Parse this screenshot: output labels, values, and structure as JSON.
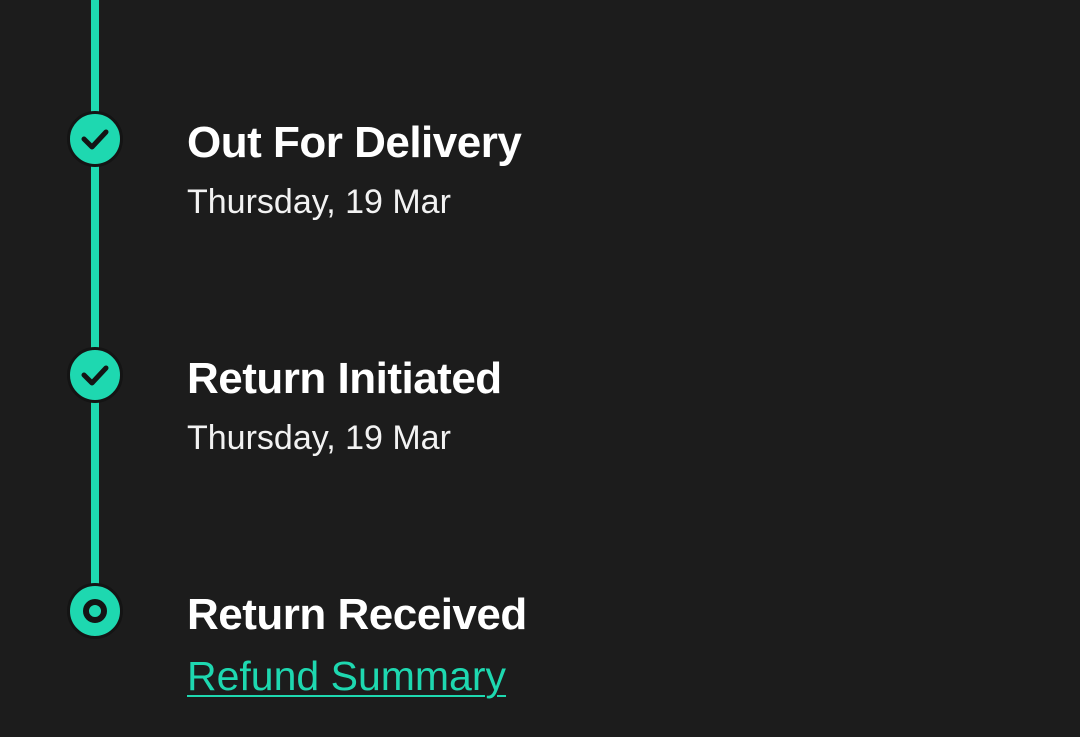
{
  "colors": {
    "background": "#1c1c1c",
    "accent": "#1ed8b0",
    "text": "#ffffff"
  },
  "timeline": {
    "steps": [
      {
        "title": "Out For Delivery",
        "date": "Thursday, 19 Mar",
        "status": "completed",
        "icon": "check-circle-icon"
      },
      {
        "title": "Return Initiated",
        "date": "Thursday, 19 Mar",
        "status": "completed",
        "icon": "check-circle-icon"
      },
      {
        "title": "Return Received",
        "status": "current",
        "icon": "current-step-dot-icon",
        "link_label": "Refund Summary"
      }
    ]
  }
}
